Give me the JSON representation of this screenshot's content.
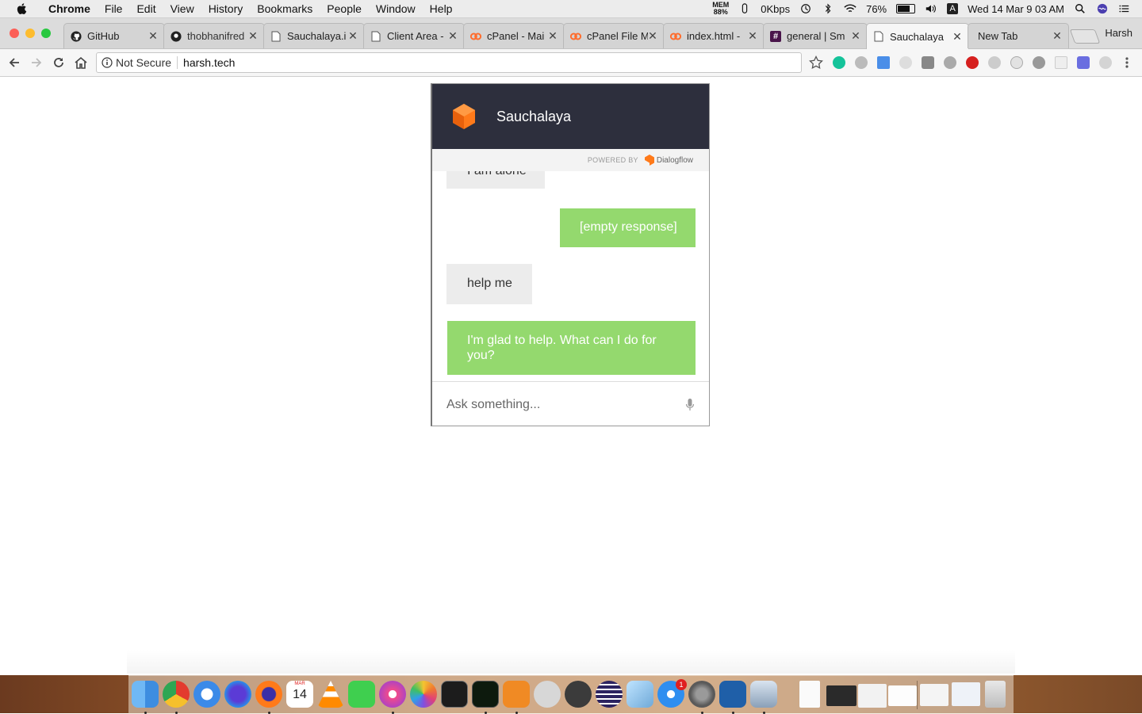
{
  "menubar": {
    "app_name": "Chrome",
    "menus": [
      "File",
      "Edit",
      "View",
      "History",
      "Bookmarks",
      "People",
      "Window",
      "Help"
    ],
    "status": {
      "mem_label": "MEM",
      "mem_value": "88%",
      "network": "0Kbps",
      "battery": "76%",
      "input_source": "A",
      "datetime": "Wed 14 Mar  9 03 AM"
    }
  },
  "browser": {
    "tabs": [
      {
        "title": "GitHub",
        "favicon": "github-icon"
      },
      {
        "title": "thobhanifred",
        "favicon": "github-icon"
      },
      {
        "title": "Sauchalaya.i",
        "favicon": "page-icon"
      },
      {
        "title": "Client Area -",
        "favicon": "page-icon"
      },
      {
        "title": "cPanel - Mai",
        "favicon": "cpanel-icon"
      },
      {
        "title": "cPanel File M",
        "favicon": "cpanel-icon"
      },
      {
        "title": "index.html -",
        "favicon": "cpanel-icon"
      },
      {
        "title": "general | Sm",
        "favicon": "slack-icon"
      },
      {
        "title": "Sauchalaya",
        "favicon": "page-icon",
        "active": true
      },
      {
        "title": "New Tab",
        "favicon": ""
      }
    ],
    "profile_name": "Harsh",
    "security_label": "Not Secure",
    "url": "harsh.tech"
  },
  "chat": {
    "agent_name": "Sauchalaya",
    "powered_by": "POWERED BY",
    "powered_brand": "Dialogflow",
    "messages": [
      {
        "from": "user",
        "text": "I am alone"
      },
      {
        "from": "bot",
        "text": "[empty response]"
      },
      {
        "from": "user",
        "text": "help me"
      },
      {
        "from": "bot",
        "text": "I'm glad to help. What can I do for you?"
      }
    ],
    "input_placeholder": "Ask something..."
  },
  "dock": {
    "calendar_month": "MAR",
    "calendar_day": "14",
    "appstore_badge": "1"
  },
  "colors": {
    "chat_header": "#2d2f3d",
    "bot_bubble": "#94d96e",
    "user_bubble": "#ececec",
    "accent_orange": "#ff7a1a"
  }
}
